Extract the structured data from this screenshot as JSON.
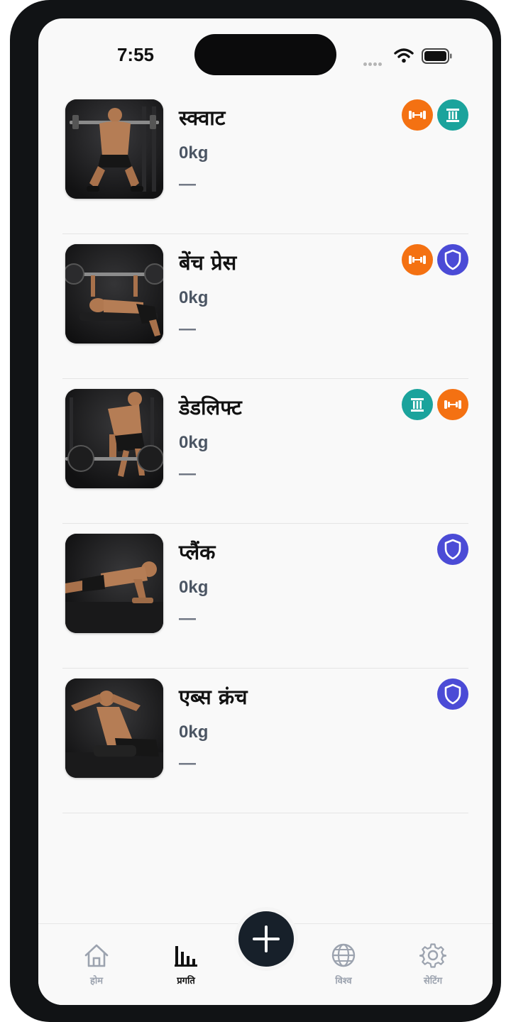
{
  "status_bar": {
    "time": "7:55"
  },
  "exercises": [
    {
      "name": "स्क्वाट",
      "weight": "0kg",
      "detail": "—",
      "badges": [
        "dumbbell",
        "pillar"
      ]
    },
    {
      "name": "बेंच प्रेस",
      "weight": "0kg",
      "detail": "—",
      "badges": [
        "dumbbell",
        "shield"
      ]
    },
    {
      "name": "डेडलिफ्ट",
      "weight": "0kg",
      "detail": "—",
      "badges": [
        "pillar",
        "dumbbell"
      ]
    },
    {
      "name": "प्लैंक",
      "weight": "0kg",
      "detail": "—",
      "badges": [
        "shield"
      ]
    },
    {
      "name": "एब्स क्रंच",
      "weight": "0kg",
      "detail": "—",
      "badges": [
        "shield"
      ]
    }
  ],
  "badge_colors": {
    "dumbbell": "#f47112",
    "pillar": "#1ba39c",
    "shield": "#4b4bd6"
  },
  "tab_bar": {
    "tabs": [
      {
        "label": "होम",
        "icon": "home-icon",
        "active": false
      },
      {
        "label": "प्रगति",
        "icon": "bar-chart-icon",
        "active": true
      },
      {
        "label": "विश्व",
        "icon": "globe-icon",
        "active": false
      },
      {
        "label": "सेटिंग",
        "icon": "gear-icon",
        "active": false
      }
    ],
    "fab_icon": "plus-icon"
  }
}
